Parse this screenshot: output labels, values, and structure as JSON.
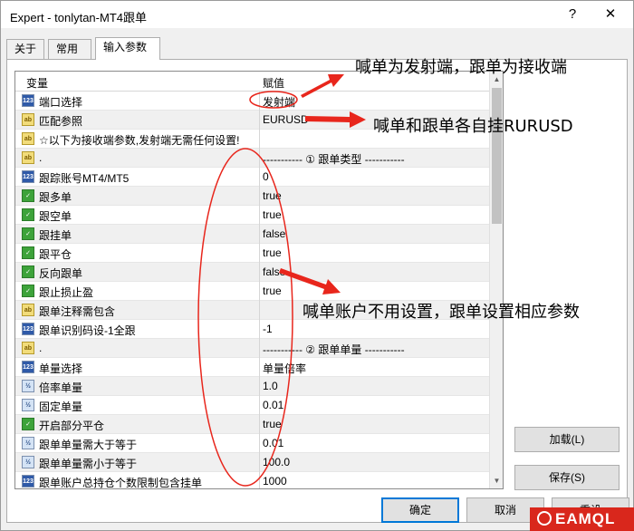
{
  "window": {
    "title": "Expert - tonlytan-MT4跟单",
    "help_glyph": "?",
    "close_glyph": "✕"
  },
  "tabs": [
    {
      "label": "关于"
    },
    {
      "label": "常用"
    },
    {
      "label": "输入参数",
      "active": true
    }
  ],
  "grid": {
    "header": {
      "name": "变量",
      "value": "赋值"
    },
    "rows": [
      {
        "icon": "123",
        "kind": "num",
        "name": "端口选择",
        "value": "发射端"
      },
      {
        "icon": "ab",
        "kind": "str",
        "name": "匹配参照",
        "value": "EURUSD"
      },
      {
        "icon": "ab",
        "kind": "str",
        "name": "☆以下为接收端参数,发射端无需任何设置!",
        "value": ""
      },
      {
        "icon": "ab",
        "kind": "str",
        "name": ".",
        "value": "----------- ① 跟单类型 -----------"
      },
      {
        "icon": "123",
        "kind": "num",
        "name": "跟踪账号MT4/MT5",
        "value": "0"
      },
      {
        "icon": "✓",
        "kind": "bool",
        "name": "跟多单",
        "value": "true"
      },
      {
        "icon": "✓",
        "kind": "bool",
        "name": "跟空单",
        "value": "true"
      },
      {
        "icon": "✓",
        "kind": "bool",
        "name": "跟挂单",
        "value": "false"
      },
      {
        "icon": "✓",
        "kind": "bool",
        "name": "跟平仓",
        "value": "true"
      },
      {
        "icon": "✓",
        "kind": "bool",
        "name": "反向跟单",
        "value": "false"
      },
      {
        "icon": "✓",
        "kind": "bool",
        "name": "跟止损止盈",
        "value": "true"
      },
      {
        "icon": "ab",
        "kind": "str",
        "name": "跟单注释需包含",
        "value": ""
      },
      {
        "icon": "123",
        "kind": "num",
        "name": "跟单识别码设-1全跟",
        "value": "-1"
      },
      {
        "icon": "ab",
        "kind": "str",
        "name": ".",
        "value": "----------- ② 跟单单量 -----------"
      },
      {
        "icon": "123",
        "kind": "num",
        "name": "单量选择",
        "value": "单量倍率"
      },
      {
        "icon": "½",
        "kind": "flt",
        "name": "倍率单量",
        "value": "1.0"
      },
      {
        "icon": "½",
        "kind": "flt",
        "name": "固定单量",
        "value": "0.01"
      },
      {
        "icon": "✓",
        "kind": "bool",
        "name": "开启部分平仓",
        "value": "true"
      },
      {
        "icon": "½",
        "kind": "flt",
        "name": "跟单单量需大于等于",
        "value": "0.01"
      },
      {
        "icon": "½",
        "kind": "flt",
        "name": "跟单单量需小于等于",
        "value": "100.0"
      },
      {
        "icon": "123",
        "kind": "num",
        "name": "跟单账户总持仓个数限制包含挂单",
        "value": "1000"
      }
    ]
  },
  "buttons": {
    "load": "加载(L)",
    "save": "保存(S)",
    "ok": "确定",
    "cancel": "取消",
    "reset": "重设"
  },
  "annotations": {
    "sender": "喊单为发射端，跟单为接收端",
    "symbol": "喊单和跟单各自挂RURUSD",
    "settings": "喊单账户不用设置，跟单设置相应参数"
  },
  "colors": {
    "annotation": "#e8261c",
    "accent": "#0078d7",
    "logo_bg": "#d9271c"
  },
  "logo": {
    "text": "EAMQL"
  }
}
